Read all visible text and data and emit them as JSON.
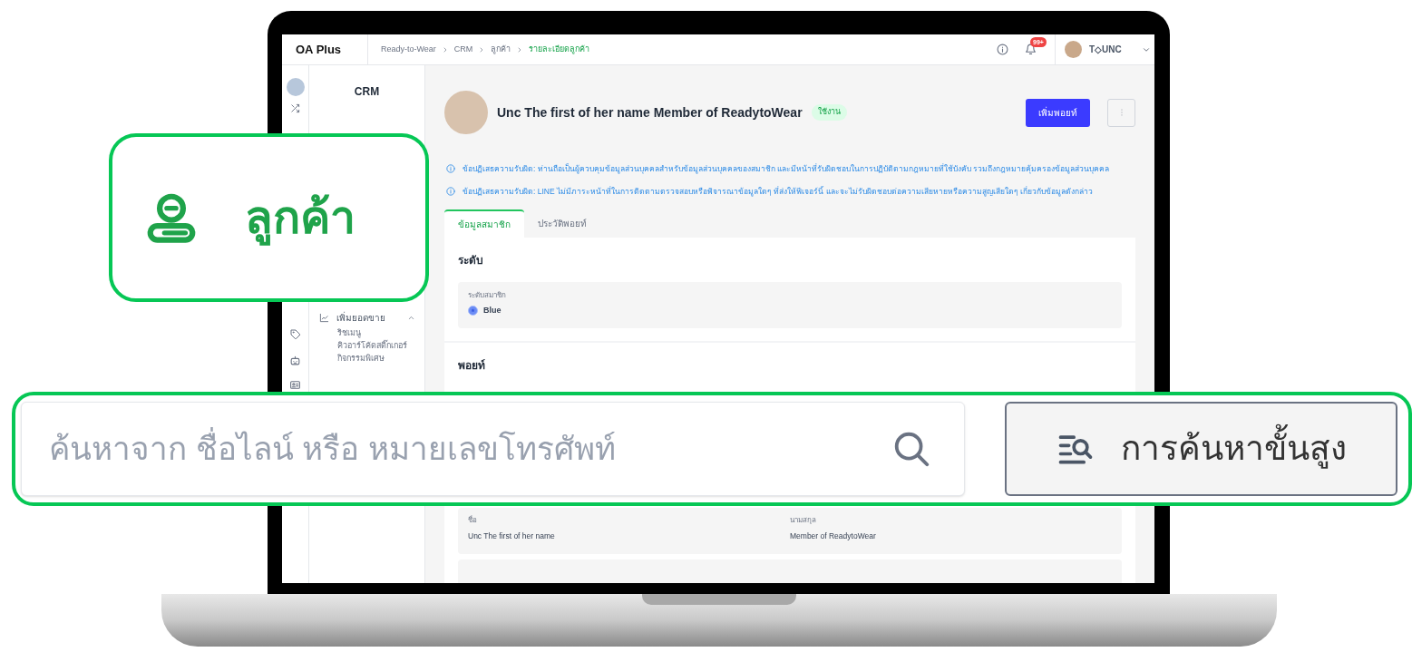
{
  "header": {
    "brand": "OA Plus",
    "breadcrumbs": [
      {
        "label": "Ready-to-Wear",
        "current": false
      },
      {
        "label": "CRM",
        "current": false
      },
      {
        "label": "ลูกค้า",
        "current": false
      },
      {
        "label": "รายละเอียดลูกค้า",
        "current": true
      }
    ],
    "notification_badge": "99+",
    "user_name": "T◇UNC"
  },
  "sidebar": {
    "title": "CRM",
    "menu": [
      {
        "label": "เพิ่มยอดขาย",
        "expanded": true,
        "children": [
          {
            "label": "ริชเมนู"
          },
          {
            "label": "คิวอาร์โค้ดสติ๊กเกอร์"
          },
          {
            "label": "กิจกรรมพิเศษ"
          }
        ]
      }
    ]
  },
  "profile": {
    "name": "Unc The first of her name Member of ReadytoWear",
    "status": "ใช้งาน",
    "add_points_button": "เพิ่มพอยท์"
  },
  "notices": [
    "ข้อปฏิเสธความรับผิด: ท่านถือเป็นผู้ควบคุมข้อมูลส่วนบุคคลสำหรับข้อมูลส่วนบุคคลของสมาชิก และมีหน้าที่รับผิดชอบในการปฏิบัติตามกฎหมายที่ใช้บังคับ รวมถึงกฎหมายคุ้มครองข้อมูลส่วนบุคคล",
    "ข้อปฏิเสธความรับผิด: LINE ไม่มีภาระหน้าที่ในการติดตามตรวจสอบหรือพิจารณาข้อมูลใดๆ ที่ส่งให้ฟีเจอร์นี้ และจะไม่รับผิดชอบต่อความเสียหายหรือความสูญเสียใดๆ เกี่ยวกับข้อมูลดังกล่าว"
  ],
  "tabs": [
    {
      "label": "ข้อมูลสมาชิก",
      "selected": true
    },
    {
      "label": "ประวัติพอยท์",
      "selected": false
    }
  ],
  "level_section": {
    "title": "ระดับ",
    "field_label": "ระดับสมาชิก",
    "value": "Blue"
  },
  "points_section": {
    "title": "พอยท์"
  },
  "personal_fields": [
    {
      "label": "ชื่อ",
      "value": "Unc The first of her name"
    },
    {
      "label": "นามสกุล",
      "value": "Member of ReadytoWear"
    }
  ],
  "callouts": {
    "menu_item": {
      "label": "ลูกค้า"
    },
    "search": {
      "placeholder": "ค้นหาจาก ชื่อไลน์ หรือ หมายเลขโทรศัพท์",
      "advanced_button": "การค้นหาขั้นสูง"
    }
  }
}
